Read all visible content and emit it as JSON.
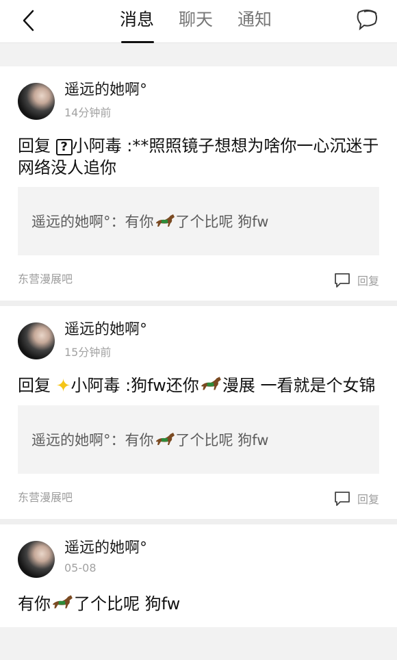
{
  "tabs": [
    "消息",
    "聊天",
    "通知"
  ],
  "cards": [
    {
      "username": "遥远的她啊°",
      "time": "14分钟前",
      "content_prefix": "回复 ",
      "content_rest": "小阿毒 :**照照镜子想想为啥你一心沉迷于网络没人追你",
      "quote_pre": "遥远的她啊°：有你",
      "quote_post": "了个比呢 狗fw",
      "forum": "东营漫展吧",
      "reply_label": "回复"
    },
    {
      "username": "遥远的她啊°",
      "time": "15分钟前",
      "content_prefix": "回复 ",
      "content_mid": "小阿毒 :狗fw还你",
      "content_post": "漫展 一看就是个女锦",
      "quote_pre": "遥远的她啊°：有你",
      "quote_post": "了个比呢 狗fw",
      "forum": "东营漫展吧",
      "reply_label": "回复"
    },
    {
      "username": "遥远的她啊°",
      "time": "05-08",
      "content_pre": "有你",
      "content_post": "了个比呢 狗fw"
    }
  ]
}
